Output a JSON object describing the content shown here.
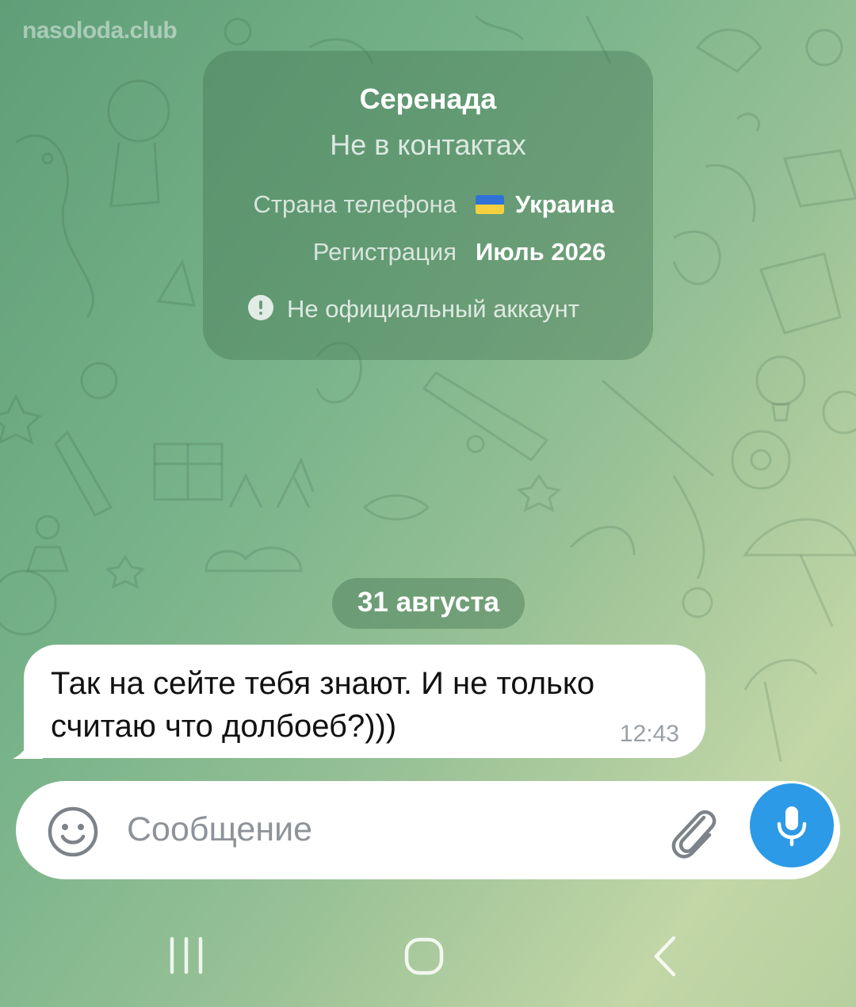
{
  "watermark": "nasoloda.club",
  "contact_info": {
    "name": "Серенада",
    "status": "Не в контактах",
    "phone_country_label": "Страна телефона",
    "phone_country_value": "Украина",
    "registration_label": "Регистрация",
    "registration_value": "Июль 2026",
    "official_notice": "Не официальный аккаунт"
  },
  "chat": {
    "date_separator": "31 августа",
    "messages": [
      {
        "text": "Так на сейте тебя знают. И не только считаю что долбоеб?)))",
        "time": "12:43",
        "direction": "incoming"
      }
    ]
  },
  "composer": {
    "placeholder": "Сообщение",
    "left_icon": "smile-icon",
    "attach_icon": "paperclip-icon",
    "send_icon": "microphone-icon",
    "accent_color": "#2c9ae6"
  },
  "navigation_bar": {
    "buttons": [
      "recent-apps-icon",
      "home-icon",
      "back-icon"
    ]
  }
}
